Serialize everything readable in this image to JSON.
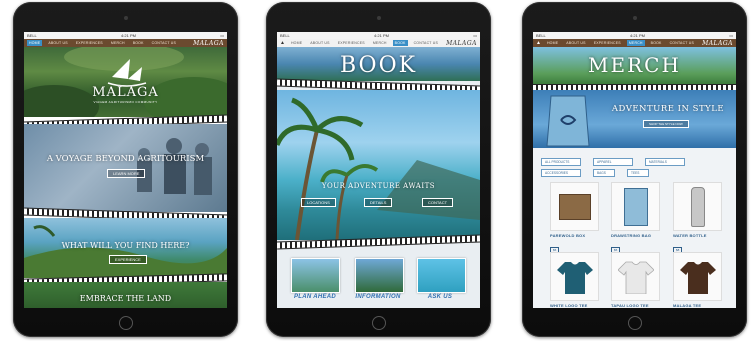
{
  "status": {
    "carrier": "BELL",
    "time": "4:21 PM"
  },
  "brand": "MALAGA",
  "nav": [
    "HOME",
    "ABOUT US",
    "EXPERIENCES",
    "MERCH",
    "BOOK",
    "CONTACT US"
  ],
  "tablet1": {
    "logo": "MALAGA",
    "tagline": "VIAGEM AGRITURISMO COMMUNITY",
    "hero1": "A VOYAGE BEYOND AGRITOURISM",
    "button1": "LEARN MORE",
    "hero2": "WHAT WILL YOU FIND HERE?",
    "button2": "EXPERIENCE",
    "hero3": "EMBRACE THE LAND"
  },
  "tablet2": {
    "title": "BOOK",
    "subtitle": "YOUR ADVENTURE AWAITS",
    "buttons": [
      "LOCATIONS",
      "DETAILS",
      "CONTACT"
    ],
    "thumbs": [
      "PLAN AHEAD",
      "INFORMATION",
      "ASK US"
    ]
  },
  "tablet3": {
    "title": "MERCH",
    "subtitle": "ADVENTURE IN STYLE",
    "subbutton": "SHOP THE STYLE NOW",
    "filters": [
      "ALL PRODUCTS",
      "APPAREL",
      "MATERIALS",
      "ACCESSORIES",
      "BAGS",
      "TEES"
    ],
    "products": [
      {
        "name": "PAREWOLD BOX",
        "price": "$5",
        "color": "#8b6a45"
      },
      {
        "name": "DRAWSTRING BAG",
        "price": "$5",
        "color": "#8fbcd8"
      },
      {
        "name": "WATER BOTTLE",
        "price": "$8",
        "color": "#c7c7c7"
      },
      {
        "name": "WHITE LOGO TEE",
        "price": "$2",
        "color": "#1f5f74"
      },
      {
        "name": "TAPAU LOGO TEE",
        "price": "$2",
        "color": "#e8e8e8"
      },
      {
        "name": "MALAGA TEE",
        "price": "$2",
        "color": "#4a2e1e"
      }
    ]
  }
}
